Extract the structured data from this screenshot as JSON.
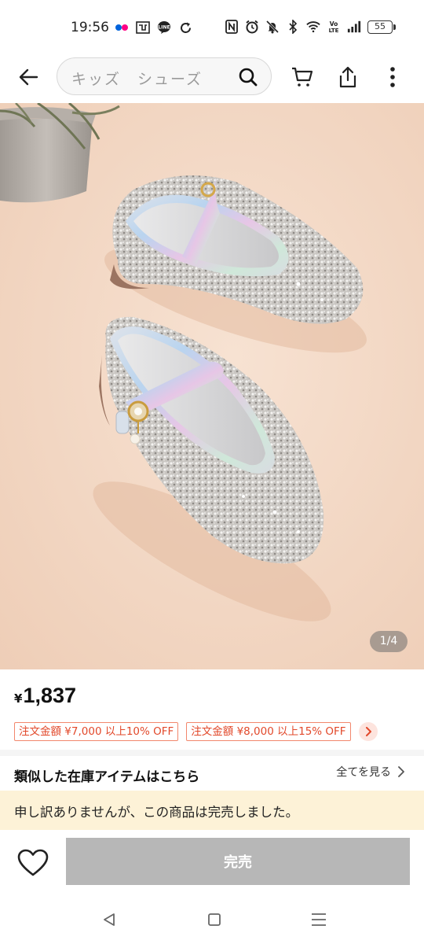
{
  "status_bar": {
    "time": "19:56",
    "battery": "55"
  },
  "header": {
    "search_placeholder": "キッズ　シューズ",
    "icons": [
      "back-arrow-icon",
      "search-icon",
      "cart-icon",
      "share-icon",
      "more-vertical-icon"
    ]
  },
  "gallery": {
    "counter": "1/4"
  },
  "product": {
    "currency": "¥",
    "price": "1,837",
    "promos": [
      "注文金額 ¥7,000 以上10% OFF",
      "注文金額 ¥8,000 以上15% OFF"
    ]
  },
  "similar": {
    "title": "類似した在庫アイテムはこちら",
    "view_all": "全てを見る"
  },
  "notice": {
    "sold_out_message": "申し訳ありませんが、この商品は完売しました。"
  },
  "actions": {
    "sold_out_button": "完売"
  },
  "colors": {
    "promo_red": "#e2492b",
    "sold_out_banner": "#fdf2d7",
    "disabled_button": "#b7b7b7",
    "image_background": "#f3d8c4"
  }
}
